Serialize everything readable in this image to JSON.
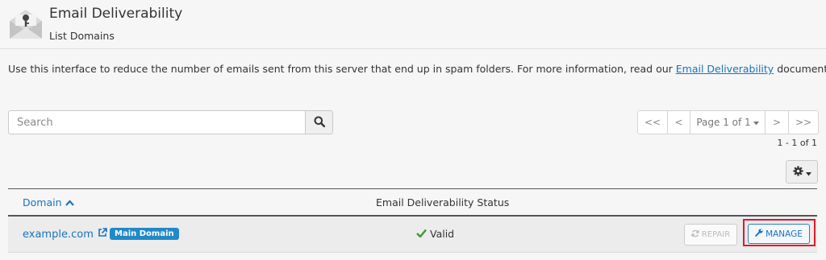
{
  "header": {
    "title": "Email Deliverability",
    "subtitle": "List Domains",
    "icon": "envelope-key-icon"
  },
  "description": {
    "text_before": "Use this interface to reduce the number of emails sent from this server that end up in spam folders. For more information, read our ",
    "link_text": "Email Deliverability",
    "text_after": " documentation."
  },
  "search": {
    "placeholder": "Search",
    "value": "",
    "button_icon": "search-icon"
  },
  "pagination": {
    "first": "<<",
    "prev": "<",
    "page_label": "Page 1 of 1",
    "next": ">",
    "last": ">>",
    "range": "1 - 1 of 1"
  },
  "settings": {
    "icon": "gear-icon"
  },
  "table": {
    "columns": [
      {
        "label": "Domain",
        "sort": "ascending"
      },
      {
        "label": "Email Deliverability Status"
      }
    ],
    "rows": [
      {
        "domain": "example.com",
        "badge": "Main Domain",
        "status": "Valid",
        "repair_label": "REPAIR",
        "manage_label": "MANAGE"
      }
    ]
  },
  "colors": {
    "link": "#1a72bf",
    "badge": "#2189c7",
    "valid": "#3c9a2f",
    "highlight": "#e01931"
  }
}
